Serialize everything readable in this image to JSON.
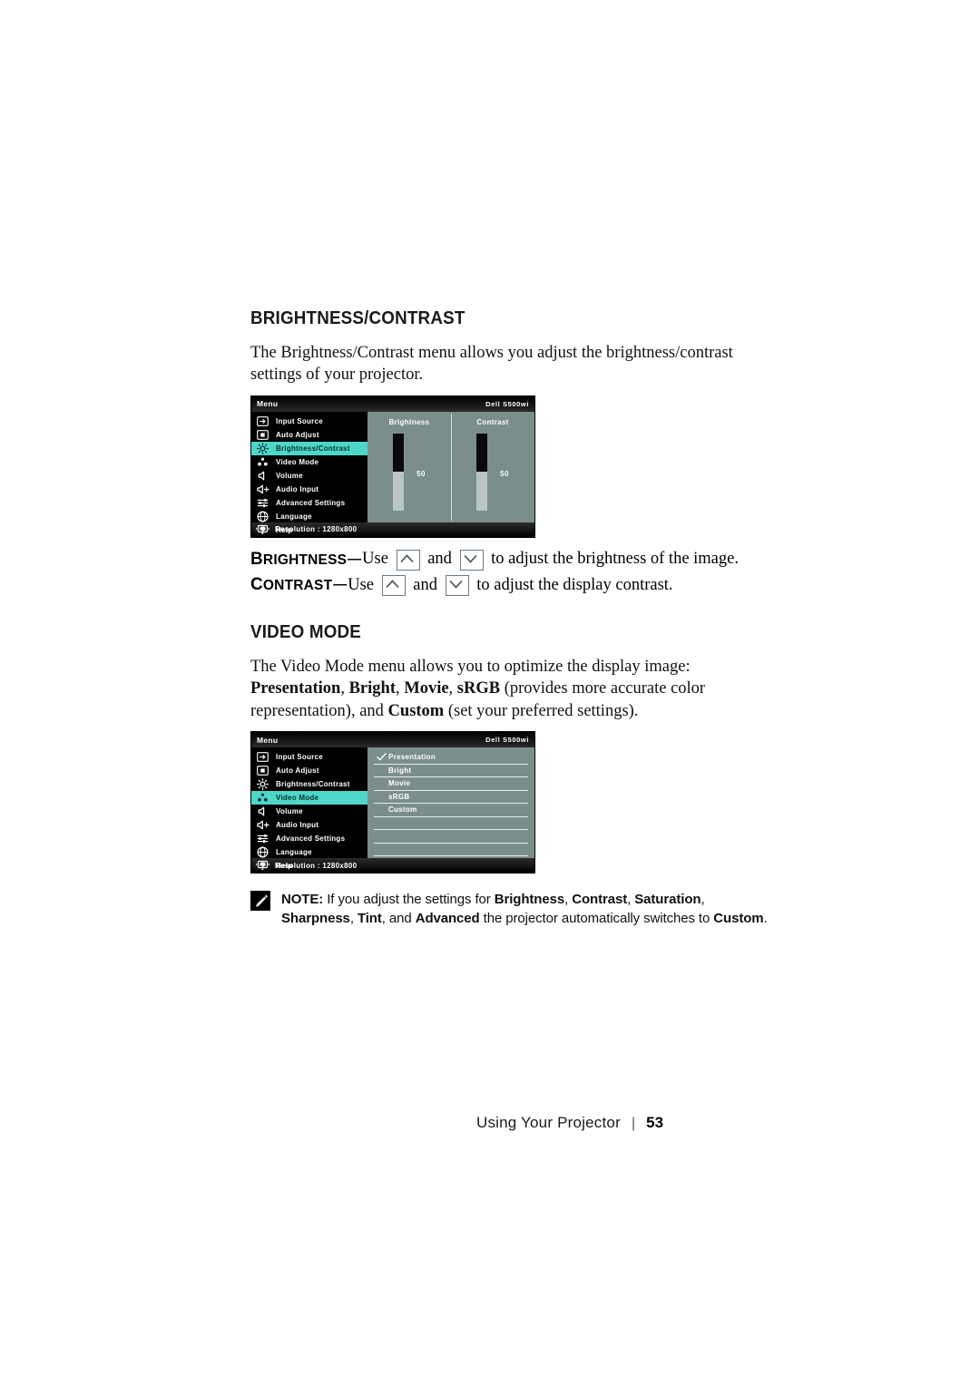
{
  "page": {
    "footer_label": "Using Your Projector",
    "footer_separator": "|",
    "footer_page_number": "53"
  },
  "sections": {
    "brightness_contrast": {
      "heading": "BRIGHTNESS/CONTRAST",
      "intro": "The Brightness/Contrast menu allows you adjust the brightness/contrast settings of your projector.",
      "keylines": [
        {
          "term_first": "B",
          "term_rest": "RIGHTNESS",
          "dash": "—",
          "text_before": "Use ",
          "text_middle": " and ",
          "text_after": " to adjust the brightness of the image.",
          "key_up": "up-arrow-key",
          "key_down": "down-arrow-key"
        },
        {
          "term_first": "C",
          "term_rest": "ONTRAST",
          "dash": "—",
          "text_before": "Use ",
          "text_middle": " and ",
          "text_after": " to adjust the display contrast.",
          "key_up": "up-arrow-key",
          "key_down": "down-arrow-key"
        }
      ]
    },
    "video_mode": {
      "heading": "VIDEO MODE",
      "intro_part1": "The Video Mode menu allows you to optimize the display image: ",
      "intro_bold1": "Presentation",
      "intro_part2": ", ",
      "intro_bold2": "Bright",
      "intro_part3": ", ",
      "intro_bold3": "Movie",
      "intro_part4": ", ",
      "intro_bold4": "sRGB",
      "intro_part5": " (provides more accurate color representation), and ",
      "intro_bold5": "Custom",
      "intro_part6": " (set your preferred settings)."
    }
  },
  "osd_menu_1": {
    "title": "Menu",
    "model": "Dell  S500wi",
    "resolution_text": "Resolution : 1280x800",
    "sidebar_items": [
      {
        "label": "Input Source",
        "icon": "input-source-icon",
        "selected": false
      },
      {
        "label": "Auto Adjust",
        "icon": "auto-adjust-icon",
        "selected": false
      },
      {
        "label": "Brightness/Contrast",
        "icon": "brightness-icon",
        "selected": true
      },
      {
        "label": "Video Mode",
        "icon": "video-mode-icon",
        "selected": false
      },
      {
        "label": "Volume",
        "icon": "volume-icon",
        "selected": false
      },
      {
        "label": "Audio Input",
        "icon": "audio-input-icon",
        "selected": false
      },
      {
        "label": "Advanced Settings",
        "icon": "advanced-settings-icon",
        "selected": false
      },
      {
        "label": "Language",
        "icon": "language-globe-icon",
        "selected": false
      },
      {
        "label": "Help",
        "icon": "help-icon",
        "selected": false
      }
    ],
    "sliders": [
      {
        "caption": "Brightness",
        "value": "50",
        "fill_percent": 50
      },
      {
        "caption": "Contrast",
        "value": "50",
        "fill_percent": 50
      }
    ]
  },
  "osd_menu_2": {
    "title": "Menu",
    "model": "Dell  S500wi",
    "resolution_text": "Resolution : 1280x800",
    "sidebar_items": [
      {
        "label": "Input Source",
        "icon": "input-source-icon",
        "selected": false
      },
      {
        "label": "Auto Adjust",
        "icon": "auto-adjust-icon",
        "selected": false
      },
      {
        "label": "Brightness/Contrast",
        "icon": "brightness-icon",
        "selected": false
      },
      {
        "label": "Video Mode",
        "icon": "video-mode-icon",
        "selected": true
      },
      {
        "label": "Volume",
        "icon": "volume-icon",
        "selected": false
      },
      {
        "label": "Audio Input",
        "icon": "audio-input-icon",
        "selected": false
      },
      {
        "label": "Advanced Settings",
        "icon": "advanced-settings-icon",
        "selected": false
      },
      {
        "label": "Language",
        "icon": "language-globe-icon",
        "selected": false
      },
      {
        "label": "Help",
        "icon": "help-icon",
        "selected": false
      }
    ],
    "options": [
      {
        "label": "Presentation",
        "checked": true
      },
      {
        "label": "Bright",
        "checked": false
      },
      {
        "label": "Movie",
        "checked": false
      },
      {
        "label": "sRGB",
        "checked": false
      },
      {
        "label": "Custom",
        "checked": false
      },
      {
        "label": "",
        "checked": false
      },
      {
        "label": "",
        "checked": false
      },
      {
        "label": "",
        "checked": false
      }
    ]
  },
  "note": {
    "icon": "note-pencil-icon",
    "label": "NOTE:",
    "text_1": " If you adjust the settings for ",
    "bold_1": "Brightness",
    "text_2": ", ",
    "bold_2": "Contrast",
    "text_3": ", ",
    "bold_3": "Saturation",
    "text_4": ", ",
    "bold_4": "Sharpness",
    "text_5": ", ",
    "bold_5": "Tint",
    "text_6": ", and ",
    "bold_6": "Advanced",
    "text_7": " the projector automatically switches to ",
    "bold_7": "Custom",
    "text_8": "."
  },
  "colors": {
    "osd_highlight": "#4ed6c9",
    "osd_panel": "#7b8e8b",
    "osd_background": "#000000",
    "slider_fill": "#0a0a0a",
    "slider_track": "#b9c6c4"
  }
}
